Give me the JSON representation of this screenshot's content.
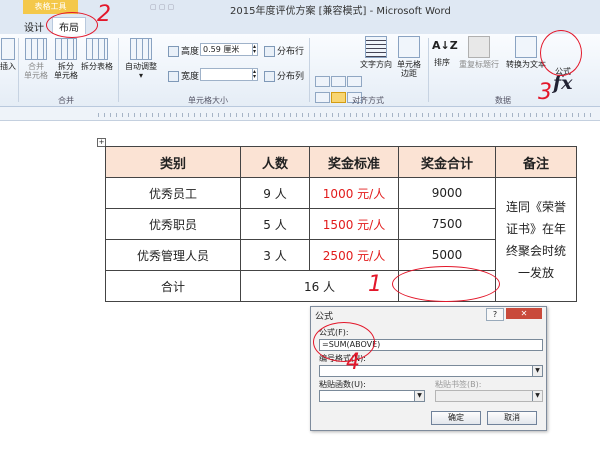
{
  "window": {
    "context_tab": "表格工具",
    "title": "2015年度评优方案 [兼容模式] - Microsoft Word"
  },
  "tabs": [
    {
      "label": "设计",
      "active": false
    },
    {
      "label": "布局",
      "active": true
    }
  ],
  "ribbon": {
    "merge_group": {
      "label": "合并",
      "insert_partial": "插入",
      "merge_cells": "合并\n单元格",
      "split_cells": "拆分\n单元格",
      "split_table": "拆分表格"
    },
    "cell_size_group": {
      "label": "单元格大小",
      "autofit": "自动调整",
      "height_label": "高度:",
      "height_value": "0.59 厘米",
      "width_label": "宽度:",
      "width_value": "",
      "distribute_rows": "分布行",
      "distribute_cols": "分布列"
    },
    "alignment_group": {
      "label": "对齐方式",
      "text_direction": "文字方向",
      "cell_margins": "单元格\n边距"
    },
    "data_group": {
      "label": "数据",
      "sort": "排序",
      "repeat_header": "重复标题行",
      "convert_to_text": "转换为文本",
      "formula": "公式",
      "formula_glyph": "fx"
    }
  },
  "table": {
    "headers": [
      "类别",
      "人数",
      "奖金标准",
      "奖金合计",
      "备注"
    ],
    "rows": [
      [
        "优秀员工",
        "9 人",
        "1000 元/人",
        "9000"
      ],
      [
        "优秀职员",
        "5 人",
        "1500 元/人",
        "7500"
      ],
      [
        "优秀管理人员",
        "3 人",
        "2500 元/人",
        "5000"
      ]
    ],
    "total_label": "合计",
    "total_people": "16 人",
    "total_amount": "",
    "remark": "连同《荣誉证书》在年终聚会时统一发放"
  },
  "dialog": {
    "title": "公式",
    "help": "?",
    "close": "✕",
    "formula_label": "公式(F):",
    "formula_value": "=SUM(ABOVE)",
    "number_format_label": "编号格式(N):",
    "paste_function_label": "粘贴函数(U):",
    "paste_bookmark_label": "粘贴书签(B):",
    "ok": "确定",
    "cancel": "取消"
  },
  "annotations": [
    "1",
    "2",
    "3",
    "4"
  ],
  "colors": {
    "accent_red": "#e21b1b",
    "header_fill": "#fbe3d4",
    "context_tab": "#f4c84a"
  }
}
